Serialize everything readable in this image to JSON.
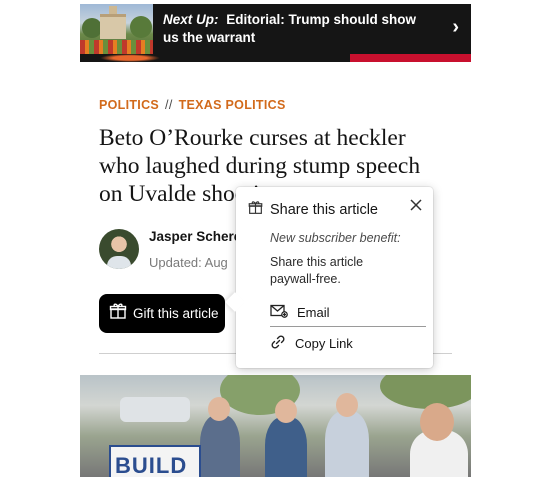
{
  "next_up": {
    "label": "Next Up:",
    "title": "Editorial: Trump should show us the warrant",
    "arrow": "›"
  },
  "breadcrumb": {
    "section": "POLITICS",
    "separator": "//",
    "subsection": "TEXAS POLITICS"
  },
  "article": {
    "headline": "Beto O’Rourke curses at heckler who laughed during stump speech on Uvalde shooting",
    "author": "Jasper Scherer,",
    "updated": "Updated: Aug"
  },
  "gift_button": {
    "label": "Gift this article",
    "icon": "gift-icon"
  },
  "photo": {
    "sign_text": "BUILD THE"
  },
  "share_popup": {
    "title": "Share this article",
    "benefit": "New subscriber benefit:",
    "description": "Share this article paywall-free.",
    "options": [
      {
        "label": "Email",
        "icon": "email-icon"
      },
      {
        "label": "Copy Link",
        "icon": "link-icon"
      }
    ],
    "close_icon": "close-icon"
  },
  "colors": {
    "accent": "#d26a1b",
    "banner_bg": "#151515",
    "banner_red": "#c8102e",
    "button_bg": "#000000"
  }
}
